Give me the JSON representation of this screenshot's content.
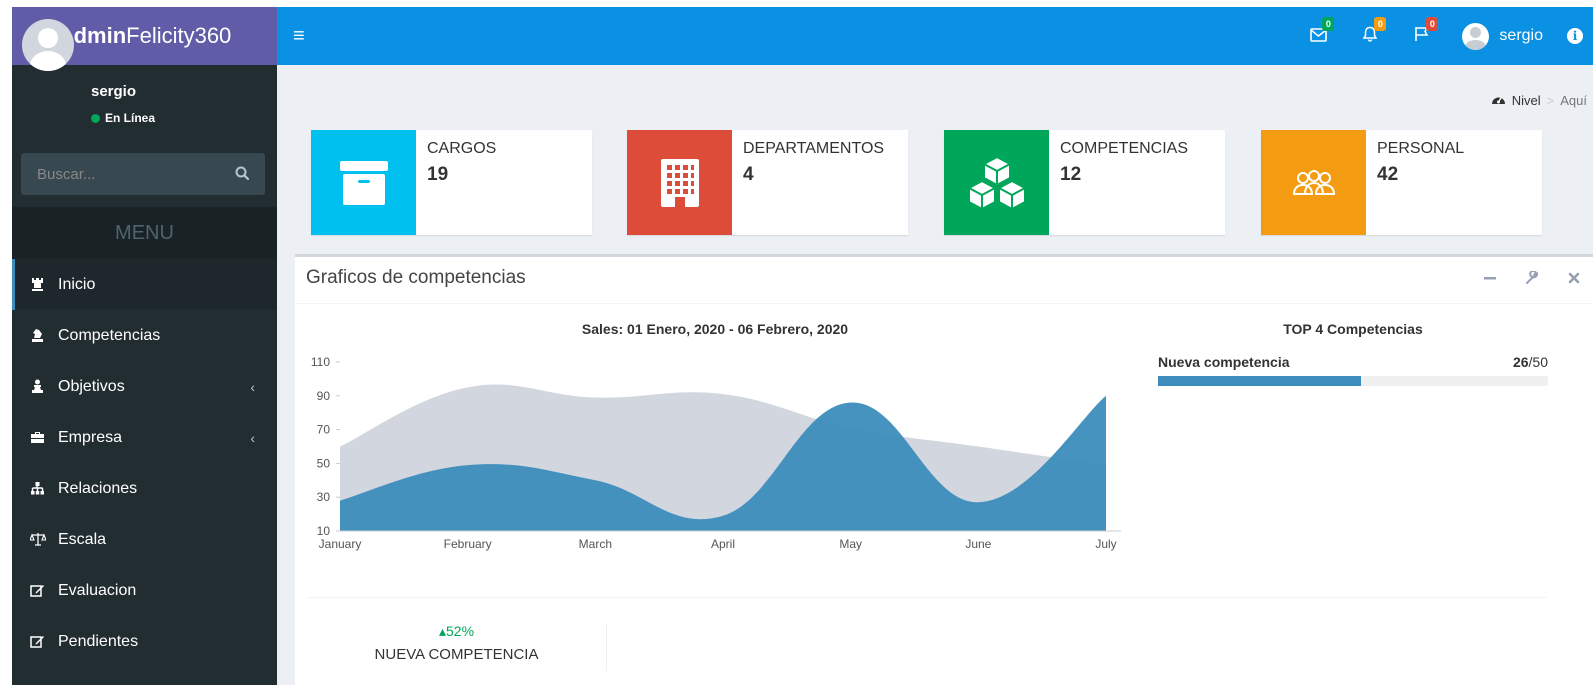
{
  "logo": {
    "bold": "Admin",
    "rest": "Felicity360"
  },
  "user": {
    "name": "sergio",
    "status": "En Línea"
  },
  "search": {
    "placeholder": "Buscar..."
  },
  "menu": {
    "header": "MENU",
    "items": [
      {
        "label": "Inicio",
        "icon": "chess-rook-icon",
        "active": true
      },
      {
        "label": "Competencias",
        "icon": "chess-knight-icon"
      },
      {
        "label": "Objetivos",
        "icon": "chess-pawn-icon",
        "has_children": true
      },
      {
        "label": "Empresa",
        "icon": "briefcase-icon",
        "has_children": true
      },
      {
        "label": "Relaciones",
        "icon": "sitemap-icon"
      },
      {
        "label": "Escala",
        "icon": "balance-scale-icon"
      },
      {
        "label": "Evaluacion",
        "icon": "edit-icon"
      },
      {
        "label": "Pendientes",
        "icon": "edit-icon"
      }
    ]
  },
  "header": {
    "messages_count": "0",
    "notifications_count": "0",
    "flags_count": "0",
    "user_name": "sergio"
  },
  "breadcrumb": {
    "level": "Nivel",
    "current": "Aquí"
  },
  "info_boxes": [
    {
      "text": "CARGOS",
      "number": "19",
      "color": "#00c0ef",
      "icon": "archive-icon"
    },
    {
      "text": "DEPARTAMENTOS",
      "number": "4",
      "color": "#dd4b39",
      "icon": "building-icon"
    },
    {
      "text": "COMPETENCIAS",
      "number": "12",
      "color": "#00a65a",
      "icon": "cubes-icon"
    },
    {
      "text": "PERSONAL",
      "number": "42",
      "color": "#f39c12",
      "icon": "users-icon"
    }
  ],
  "panel": {
    "title": "Graficos de competencias",
    "chart_title": "Sales: 01 Enero, 2020 - 06 Febrero, 2020",
    "top_title": "TOP 4 Competencias",
    "progress": {
      "label": "Nueva competencia",
      "value": "26",
      "total": "/50",
      "fraction": 0.52
    },
    "description": {
      "percentage": "52%",
      "label": "NUEVA COMPETENCIA"
    }
  },
  "chart_data": {
    "type": "area",
    "categories": [
      "January",
      "February",
      "March",
      "April",
      "May",
      "June",
      "July"
    ],
    "y_ticks": [
      10,
      30,
      50,
      70,
      90,
      110
    ],
    "ylim": [
      10,
      110
    ],
    "series": [
      {
        "values": [
          60,
          95,
          89,
          91,
          71,
          60,
          49
        ],
        "color": "#d2d6de"
      },
      {
        "values": [
          28,
          49,
          40,
          19,
          86,
          27,
          90
        ],
        "color": "#3c8dbc"
      }
    ]
  }
}
